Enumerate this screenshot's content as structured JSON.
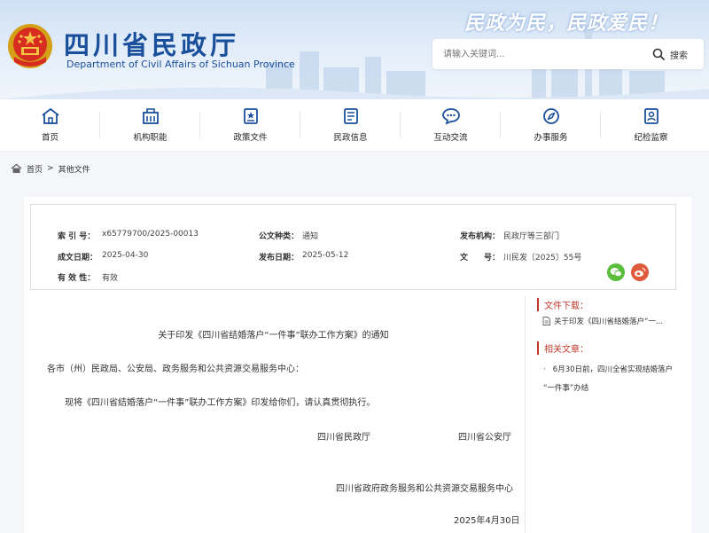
{
  "header": {
    "title": "四川省民政厅",
    "subtitle": "Department of Civil Affairs of Sichuan Province",
    "slogan": "民政为民，民政爱民！",
    "search_placeholder": "请输入关键词...",
    "search_label": "搜索"
  },
  "nav": {
    "items": [
      {
        "label": "首页",
        "icon": "home-icon"
      },
      {
        "label": "机构职能",
        "icon": "building-icon"
      },
      {
        "label": "政策文件",
        "icon": "policy-doc-icon"
      },
      {
        "label": "民政信息",
        "icon": "info-doc-icon"
      },
      {
        "label": "互动交流",
        "icon": "chat-icon"
      },
      {
        "label": "办事服务",
        "icon": "compass-icon"
      },
      {
        "label": "纪检监察",
        "icon": "inspection-icon"
      }
    ]
  },
  "breadcrumb": {
    "home": "首页",
    "sep": ">",
    "current": "其他文件"
  },
  "meta": {
    "index_label": "索 引 号：",
    "index_value": "x65779700/2025-00013",
    "type_label": "公文种类：",
    "type_value": "通知",
    "issuer_label": "发布机构：",
    "issuer_value": "民政厅等三部门",
    "created_label": "成文日期：",
    "created_value": "2025-04-30",
    "published_label": "发布日期：",
    "published_value": "2025-05-12",
    "docno_label": "文　　号：",
    "docno_value": "川民发〔2025〕55号",
    "validity_label": "有 效 性：",
    "validity_value": "有效"
  },
  "doc": {
    "title": "关于印发《四川省结婚落户“一件事”联办工作方案》的通知",
    "salutation": "各市（州）民政局、公安局、政务服务和公共资源交易服务中心：",
    "body": "现将《四川省结婚落户“一件事”联办工作方案》印发给你们，请认真贯彻执行。",
    "sign1": "四川省民政厅",
    "sign2": "四川省公安厅",
    "sign3": "四川省政府政务服务和公共资源交易服务中心",
    "date": "2025年4月30日"
  },
  "sidebar": {
    "download_title": "文件下载：",
    "download_item": "关于印发《四川省结婚落户“一...",
    "related_title": "相关文章：",
    "related_item_line1": "6月30日前，四川全省实现结婚落户",
    "related_item_line2": "“一件事”办结"
  },
  "colors": {
    "brand_blue": "#1a4f9c",
    "accent_red": "#c0392b",
    "wechat_green": "#5bbd3c",
    "weibo_red": "#e05a3c"
  }
}
